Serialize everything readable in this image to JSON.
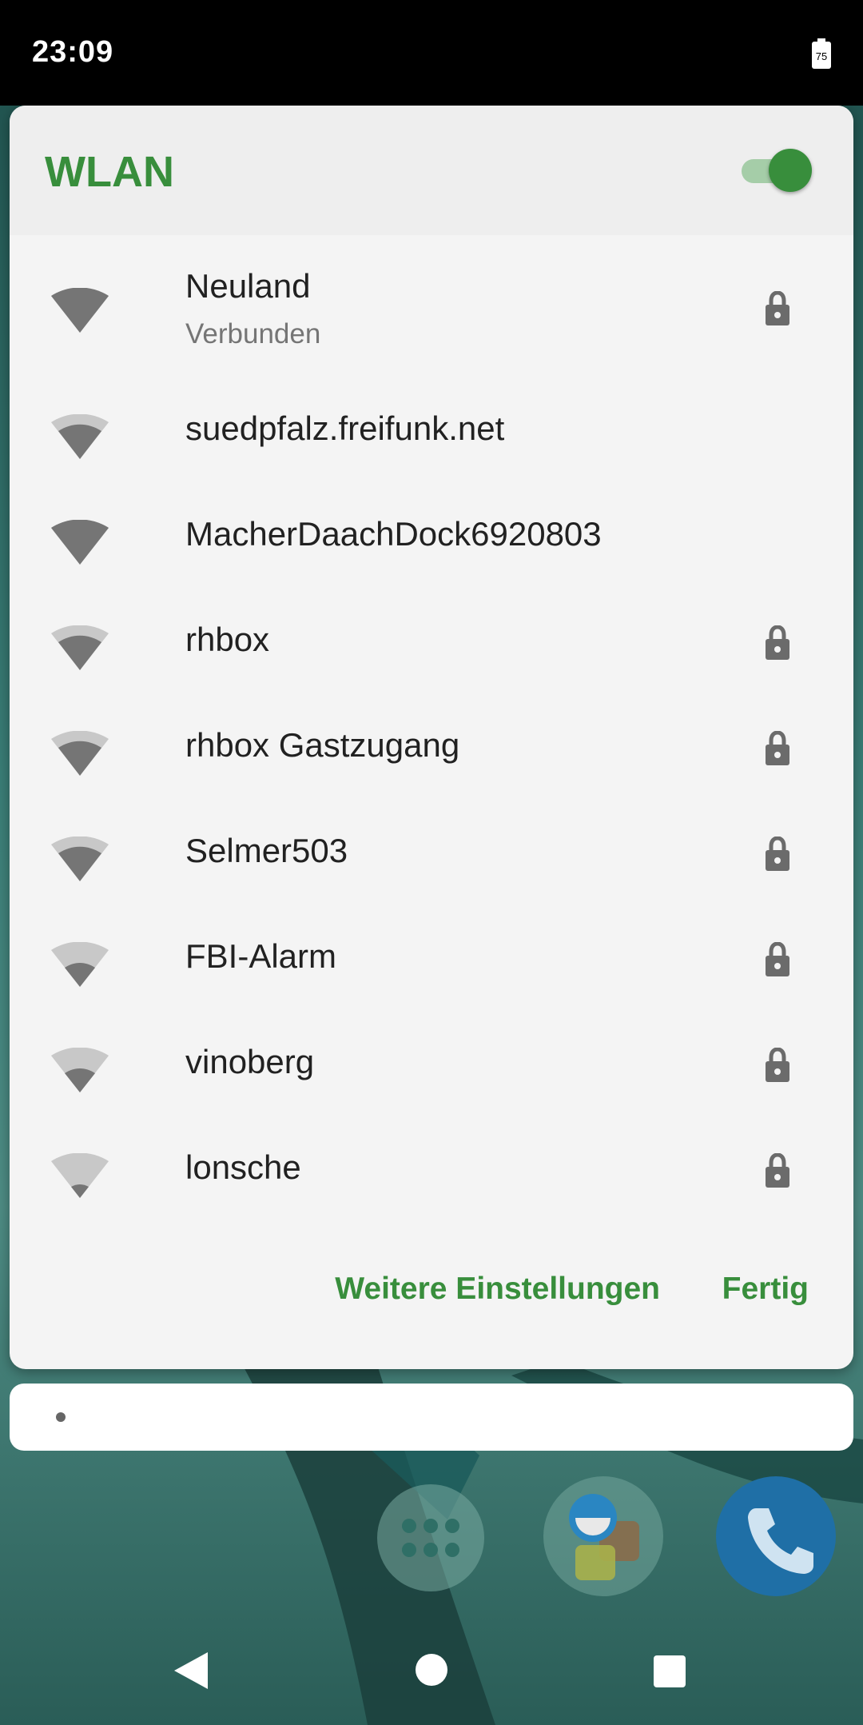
{
  "status_bar": {
    "time": "23:09",
    "battery_level": "75"
  },
  "dialog": {
    "title": "WLAN",
    "toggle_on": true,
    "networks": [
      {
        "name": "Neuland",
        "status": "Verbunden",
        "signal": 4,
        "secured": true
      },
      {
        "name": "suedpfalz.freifunk.net",
        "status": "",
        "signal": 3,
        "secured": false
      },
      {
        "name": "MacherDaachDock6920803",
        "status": "",
        "signal": 4,
        "secured": false
      },
      {
        "name": "rhbox",
        "status": "",
        "signal": 3,
        "secured": true
      },
      {
        "name": "rhbox Gastzugang",
        "status": "",
        "signal": 3,
        "secured": true
      },
      {
        "name": "Selmer503",
        "status": "",
        "signal": 3,
        "secured": true
      },
      {
        "name": "FBI-Alarm",
        "status": "",
        "signal": 2,
        "secured": true
      },
      {
        "name": "vinoberg",
        "status": "",
        "signal": 2,
        "secured": true
      },
      {
        "name": "lonsche",
        "status": "",
        "signal": 1,
        "secured": true
      }
    ],
    "more_settings_label": "Weitere Einstellungen",
    "done_label": "Fertig"
  },
  "colors": {
    "accent": "#388e3c",
    "wifi_dark": "#757575",
    "wifi_light": "#c8c8c8"
  },
  "dock": {
    "icons": [
      "app-drawer-icon",
      "contacts-icon",
      "phone-icon"
    ]
  },
  "nav": {
    "icons": [
      "back-icon",
      "home-icon",
      "recents-icon"
    ]
  }
}
